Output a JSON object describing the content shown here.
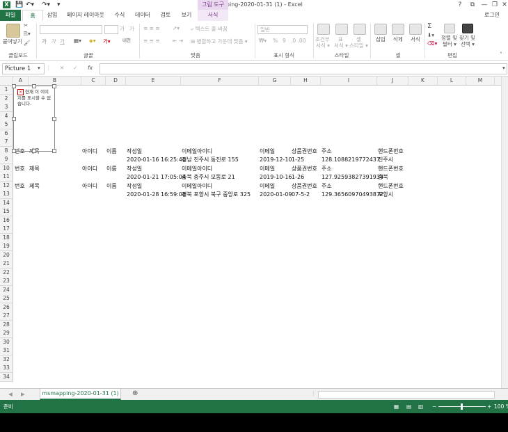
{
  "titlebar": {
    "app_icon_label": "X",
    "title": "msmapping-2020-01-31 (1) - Excel",
    "context_title": "그림 도구",
    "help": "?",
    "ribbon_toggle": "⧉",
    "minimize": "—",
    "restore": "❐",
    "close": "✕"
  },
  "tabs": {
    "file": "파일",
    "home": "홈",
    "insert": "삽입",
    "page_layout": "페이지 레이아웃",
    "formulas": "수식",
    "data": "데이터",
    "review": "검토",
    "view": "보기",
    "format": "서식",
    "login": "로그인"
  },
  "ribbon": {
    "paste": "붙여넣기",
    "clipboard_group": "클립보드",
    "font_group": "글꼴",
    "font_bold": "가",
    "font_italic": "가",
    "font_underline": "가",
    "font_grow": "가",
    "font_shrink": "가",
    "phonetic": "내천",
    "wrap_text": "텍스트 줄 바꿈",
    "merge_center": "병합하고 가운데 맞춤",
    "alignment_group": "맞춤",
    "number_format": "일반",
    "percent": "%",
    "comma": "9",
    "number_group": "표시 형식",
    "cond_format_1": "조건부",
    "cond_format_2": "서식 ▾",
    "table_format_1": "표",
    "table_format_2": "서식 ▾",
    "cell_style_1": "셀",
    "cell_style_2": "스타일 ▾",
    "styles_group": "스타일",
    "insert_cells": "삽입",
    "delete_cells": "삭제",
    "format_cells": "서식",
    "cells_group": "셀",
    "sort_filter_1": "정렬 및",
    "sort_filter_2": "필터 ▾",
    "find_select_1": "찾기 및",
    "find_select_2": "선택 ▾",
    "editing_group": "편집",
    "sum_symbol": "Σ"
  },
  "formula_bar": {
    "name_box": "Picture 1",
    "cancel": "✕",
    "enter": "✓",
    "fx": "fx"
  },
  "columns": [
    "A",
    "B",
    "C",
    "D",
    "E",
    "F",
    "G",
    "H",
    "I",
    "J",
    "K",
    "L",
    "M"
  ],
  "rows": [
    "1",
    "2",
    "3",
    "4",
    "5",
    "6",
    "7",
    "8",
    "9",
    "10",
    "11",
    "12",
    "13",
    "14",
    "15",
    "16",
    "17",
    "18",
    "19",
    "20",
    "21",
    "22",
    "23",
    "24",
    "25",
    "26",
    "27",
    "28",
    "29",
    "30",
    "31",
    "32",
    "33",
    "34"
  ],
  "picture": {
    "message": "현재 이 이미지를 표시할 수 없습니다."
  },
  "table_headers": {
    "num": "번호",
    "title": "제목",
    "user_id": "아이디",
    "name": "이름",
    "created": "작성일",
    "email_id": "이메일아이디",
    "email": "이메일",
    "product_no": "상품권번호",
    "address": "주소",
    "phone": "핸드폰번호"
  },
  "records": [
    {
      "created": "2020-01-16 16:25:46",
      "email_id": "경남 진주시 동진로 155",
      "email": "2019-12-10",
      "product_no": "1-25",
      "address": "128.1088219772437",
      "phone": "진주시"
    },
    {
      "created": "2020-01-21 17:05:04",
      "email_id": "충북 충주시 모동로 21",
      "email": "2019-10-16",
      "product_no": "1-26",
      "address": "127.92593827391934",
      "phone": "충북"
    },
    {
      "created": "2020-01-28 16:59:08",
      "email_id": "경북 포항시 북구 중앙로 325",
      "email": "2020-01-09",
      "product_no": "07-5-2",
      "address": "129.36560970493872",
      "phone": "포항시"
    }
  ],
  "sheet": {
    "tab": "msmapping-2020-01-31 (1)",
    "add": "⊕",
    "prev": "◀",
    "next": "▶"
  },
  "status": {
    "ready": "준비",
    "zoom": "100 %",
    "zoom_minus": "−",
    "zoom_plus": "+"
  }
}
